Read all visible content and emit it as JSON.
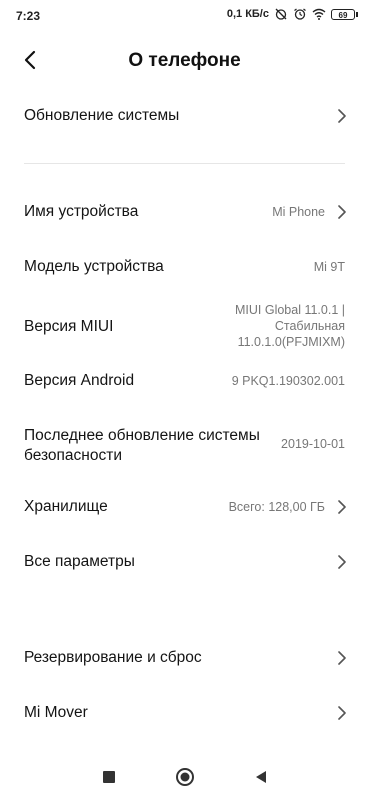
{
  "status_bar": {
    "time": "7:23",
    "network_speed": "0,1 КБ/с",
    "battery": "69"
  },
  "header": {
    "title": "О телефоне",
    "back_icon": "chevron-left-icon"
  },
  "items": [
    {
      "label": "Обновление системы",
      "value": "",
      "has_chevron": true
    },
    {
      "label": "Имя устройства",
      "value": "Mi Phone",
      "has_chevron": true
    },
    {
      "label": "Модель устройства",
      "value": "Mi 9T",
      "has_chevron": false
    },
    {
      "label": "Версия MIUI",
      "value_lines": [
        "MIUI Global 11.0.1 |",
        "Стабильная",
        "11.0.1.0(PFJMIXM)"
      ],
      "has_chevron": false
    },
    {
      "label": "Версия Android",
      "value": "9 PKQ1.190302.001",
      "has_chevron": false
    },
    {
      "label_lines": [
        "Последнее обновление системы",
        "безопасности"
      ],
      "value": "2019-10-01",
      "has_chevron": false
    },
    {
      "label": "Хранилище",
      "value": "Всего: 128,00 ГБ",
      "has_chevron": true
    },
    {
      "label": "Все параметры",
      "value": "",
      "has_chevron": true
    },
    {
      "label": "Резервирование и сброс",
      "value": "",
      "has_chevron": true
    },
    {
      "label": "Mi Mover",
      "value": "",
      "has_chevron": true
    }
  ],
  "nav_bar": {
    "recents_icon": "square-icon",
    "home_icon": "home-circle-icon",
    "back_icon": "triangle-back-icon"
  },
  "colors": {
    "text_primary": "#141414",
    "text_secondary": "#777777",
    "divider": "#e6e6e6",
    "background": "#ffffff"
  }
}
